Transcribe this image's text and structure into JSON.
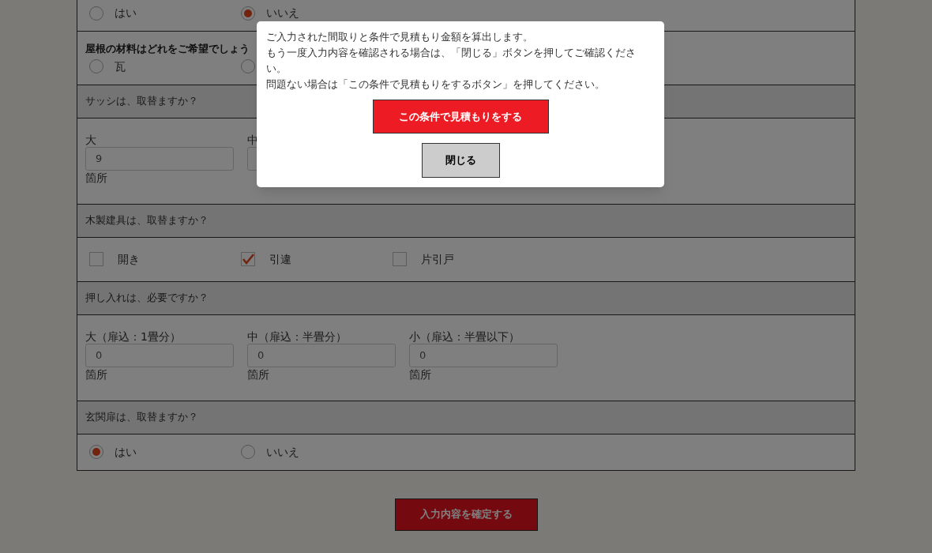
{
  "sections": [
    {
      "kind": "radio",
      "options": [
        {
          "label": "はい",
          "selected": false
        },
        {
          "label": "いいえ",
          "selected": true
        }
      ]
    },
    {
      "kind": "radio",
      "title": "屋根の材料はどれをご希望でしょう",
      "options": [
        {
          "label": "瓦",
          "selected": false
        },
        {
          "selected": false
        }
      ]
    },
    {
      "kind": "counts",
      "header": "サッシは、取替ますか？",
      "fields": [
        {
          "label": "大",
          "value": "9",
          "unit": "箇所"
        },
        {
          "label": "中"
        }
      ]
    },
    {
      "kind": "checks",
      "header": "木製建具は、取替ますか？",
      "options": [
        {
          "label": "開き",
          "checked": false
        },
        {
          "label": "引違",
          "checked": true
        },
        {
          "label": "片引戸",
          "checked": false
        }
      ]
    },
    {
      "kind": "counts",
      "header": "押し入れは、必要ですか？",
      "fields": [
        {
          "label": "大（扉込：1畳分）",
          "value": "0",
          "unit": "箇所"
        },
        {
          "label": "中（扉込：半畳分）",
          "value": "0",
          "unit": "箇所"
        },
        {
          "label": "小（扉込：半畳以下）",
          "value": "0",
          "unit": "箇所"
        }
      ]
    },
    {
      "kind": "radio",
      "header": "玄関扉は、取替ますか？",
      "options": [
        {
          "label": "はい",
          "selected": true
        },
        {
          "label": "いいえ",
          "selected": false
        }
      ]
    }
  ],
  "confirm_button": "入力内容を確定する",
  "modal": {
    "lines": [
      "ご入力された間取りと条件で見積もり金額を算出します。",
      "もう一度入力内容を確認される場合は、「閉じる」ボタンを押してご確認ください。",
      "問題ない場合は「この条件で見積もりをするボタン」を押してください。"
    ],
    "primary_button": "この条件で見積もりをする",
    "close_button": "閉じる"
  }
}
